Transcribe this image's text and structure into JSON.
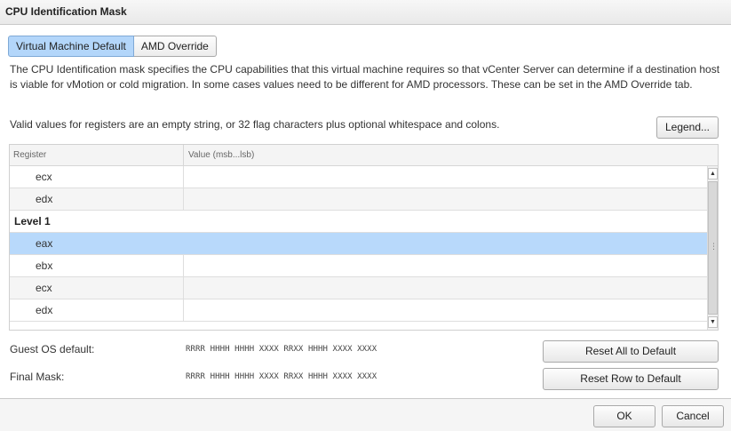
{
  "window": {
    "title": "CPU Identification Mask"
  },
  "tabs": [
    {
      "label": "Virtual Machine Default",
      "active": true
    },
    {
      "label": "AMD Override",
      "active": false
    }
  ],
  "description": "The CPU Identification mask specifies the CPU capabilities that this virtual machine requires so that vCenter Server can determine if a destination host is viable for vMotion or cold migration. In some cases values need to be different for AMD processors. These can be set in the AMD Override tab.",
  "valid_text": "Valid values for registers are an empty string, or 32 flag characters plus optional whitespace and colons.",
  "legend_button": "Legend...",
  "table": {
    "columns": [
      "Register",
      "Value (msb...lsb)"
    ],
    "rows": [
      {
        "register": "ecx",
        "value": ""
      },
      {
        "register": "edx",
        "value": ""
      },
      {
        "group": "Level 1"
      },
      {
        "register": "eax",
        "value": "",
        "selected": true
      },
      {
        "register": "ebx",
        "value": ""
      },
      {
        "register": "ecx",
        "value": ""
      },
      {
        "register": "edx",
        "value": ""
      }
    ]
  },
  "guest_os": {
    "label": "Guest OS default:",
    "value": "RRRR HHHH HHHH XXXX RRXX HHHH XXXX XXXX"
  },
  "final_mask": {
    "label": "Final Mask:",
    "value": "RRRR HHHH HHHH XXXX RRXX HHHH XXXX XXXX"
  },
  "reset_all_button": "Reset All to Default",
  "reset_row_button": "Reset Row to Default",
  "ok_button": "OK",
  "cancel_button": "Cancel",
  "colors": {
    "selected_row": "#b8d9fb",
    "active_tab": "#b3d6fa"
  },
  "icons": {
    "scroll_up": "triangle-up-icon",
    "scroll_down": "triangle-down-icon",
    "grip": "grip-icon"
  }
}
